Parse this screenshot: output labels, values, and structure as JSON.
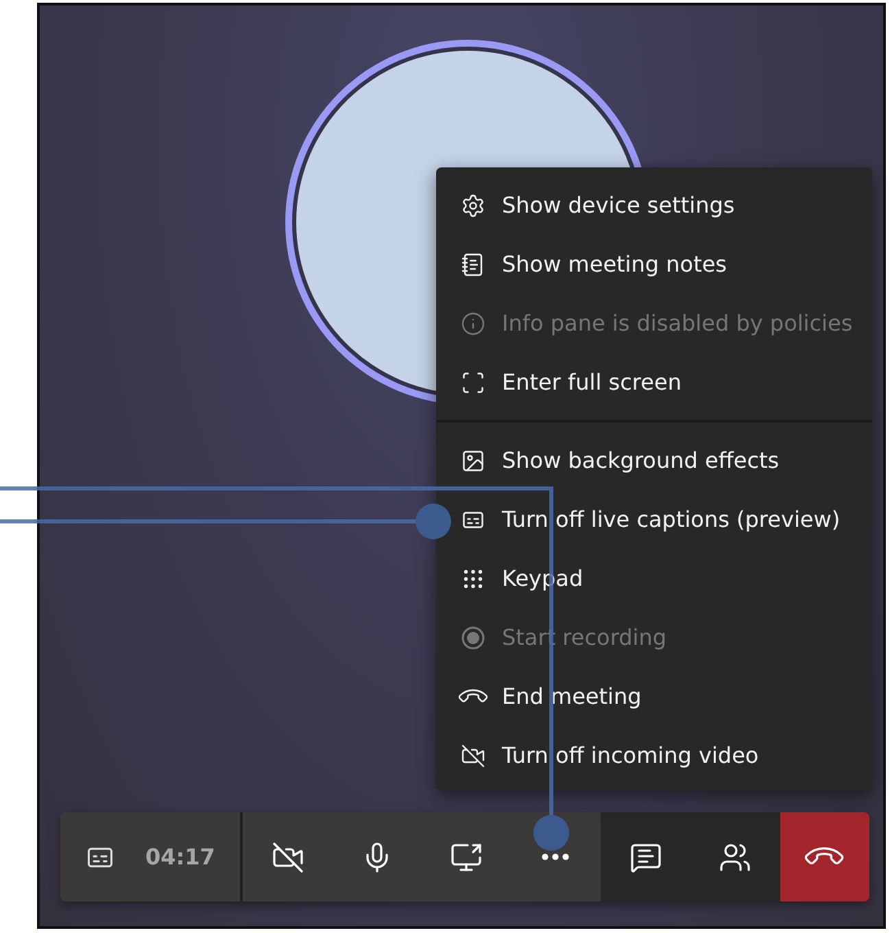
{
  "menu": {
    "items": [
      {
        "kind": "item",
        "label": "Show device settings",
        "disabled": false
      },
      {
        "kind": "item",
        "label": "Show meeting notes",
        "disabled": false
      },
      {
        "kind": "item",
        "label": "Info pane is disabled by policies",
        "disabled": true
      },
      {
        "kind": "item",
        "label": "Enter full screen",
        "disabled": false
      },
      {
        "kind": "divider"
      },
      {
        "kind": "item",
        "label": "Show background effects",
        "disabled": false
      },
      {
        "kind": "item",
        "label": "Turn off live captions (preview)",
        "disabled": false
      },
      {
        "kind": "item",
        "label": "Keypad",
        "disabled": false
      },
      {
        "kind": "item",
        "label": "Start recording",
        "disabled": true
      },
      {
        "kind": "item",
        "label": "End meeting",
        "disabled": false
      },
      {
        "kind": "item",
        "label": "Turn off incoming video",
        "disabled": false
      }
    ]
  },
  "toolbar": {
    "timer": "04:17",
    "buttons": [
      {
        "kind": "control"
      },
      {
        "kind": "control"
      },
      {
        "kind": "control"
      },
      {
        "kind": "control"
      },
      {
        "kind": "panel"
      },
      {
        "kind": "panel"
      },
      {
        "kind": "leave"
      }
    ]
  }
}
